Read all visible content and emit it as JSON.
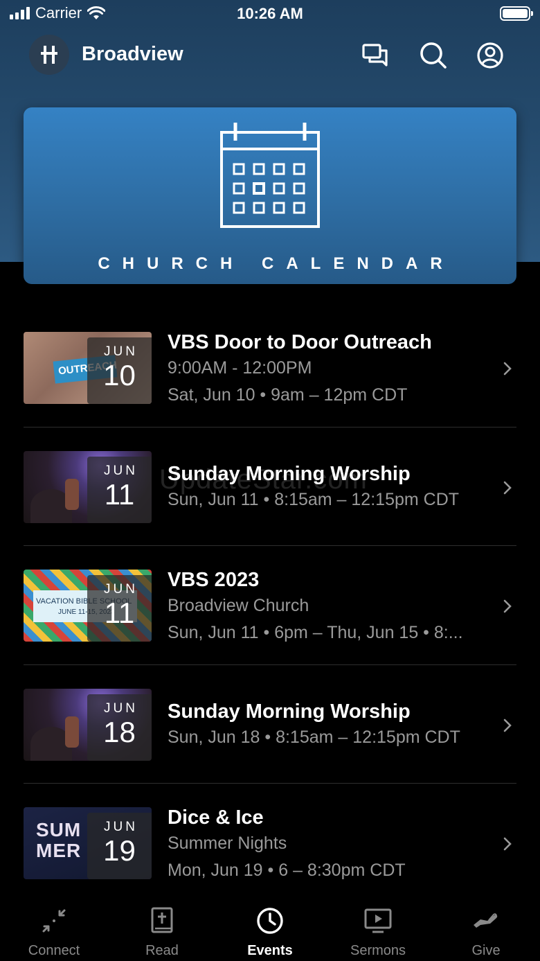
{
  "status_bar": {
    "carrier": "Carrier",
    "time": "10:26 AM"
  },
  "header": {
    "title": "Broadview"
  },
  "banner": {
    "title": "CHURCH CALENDAR"
  },
  "events": [
    {
      "title": "VBS Door to Door Outreach",
      "line1": "9:00AM - 12:00PM",
      "line2": "Sat, Jun 10 • 9am – 12pm CDT",
      "month": "JUN",
      "day": "10",
      "thumb_text": "OUTREACH"
    },
    {
      "title": "Sunday Morning Worship",
      "line1": "Sun, Jun 11 • 8:15am – 12:15pm CDT",
      "line2": "",
      "month": "JUN",
      "day": "11"
    },
    {
      "title": "VBS 2023",
      "line1": "Broadview Church",
      "line2": "Sun, Jun 11 • 6pm – Thu, Jun 15 • 8:...",
      "month": "JUN",
      "day": "11",
      "thumb_text": "VACATION BIBLE SCHOOL",
      "thumb_text2": "JUNE 11-15, 2023"
    },
    {
      "title": "Sunday Morning Worship",
      "line1": "Sun, Jun 18 • 8:15am – 12:15pm CDT",
      "line2": "",
      "month": "JUN",
      "day": "18"
    },
    {
      "title": "Dice & Ice",
      "line1": "Summer Nights",
      "line2": "Mon, Jun 19 • 6 – 8:30pm CDT",
      "month": "JUN",
      "day": "19",
      "thumb_text": "SUM MER"
    }
  ],
  "watermark": "UpdateStar.com",
  "tabs": [
    {
      "label": "Connect",
      "icon": "connect-icon",
      "active": false
    },
    {
      "label": "Read",
      "icon": "bible-icon",
      "active": false
    },
    {
      "label": "Events",
      "icon": "clock-icon",
      "active": true
    },
    {
      "label": "Sermons",
      "icon": "play-screen-icon",
      "active": false
    },
    {
      "label": "Give",
      "icon": "give-hand-icon",
      "active": false
    }
  ],
  "colors": {
    "header_bg": "#264d70",
    "banner": "#3582c4",
    "tab_active": "#ffffff",
    "tab_inactive": "#8a8a8a",
    "subtext": "#9a9a9a"
  }
}
